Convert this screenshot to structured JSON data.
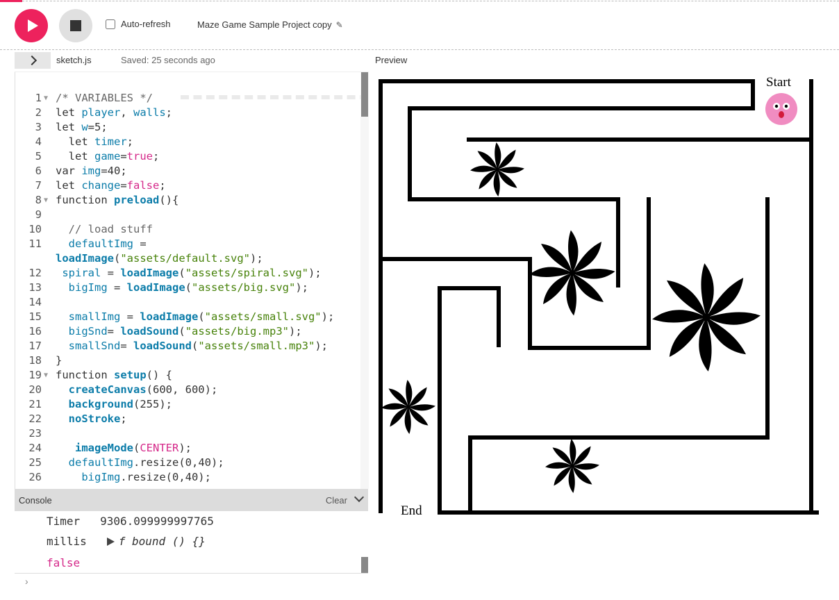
{
  "toolbar": {
    "autorefresh_label": "Auto-refresh",
    "project_name": "Maze Game Sample Project copy",
    "icons": {
      "play": "play-icon",
      "stop": "stop-icon",
      "edit": "pencil-icon"
    },
    "colors": {
      "accent": "#ed225d",
      "stop_bg": "#e0e0e0"
    }
  },
  "editor": {
    "file_name": "sketch.js",
    "saved_status": "Saved: 25 seconds ago",
    "line_numbers": [
      "1",
      "2",
      "3",
      "4",
      "5",
      "6",
      "7",
      "8",
      "9",
      "10",
      "11",
      "",
      "12",
      "13",
      "14",
      "15",
      "16",
      "17",
      "18",
      "19",
      "20",
      "21",
      "22",
      "23",
      "24",
      "25",
      "26"
    ]
  },
  "preview": {
    "label": "Preview",
    "start_label": "Start",
    "end_label": "End"
  },
  "console": {
    "title": "Console",
    "clear_label": "Clear",
    "lines": {
      "timer_key": "Timer",
      "timer_value": "9306.099999997765",
      "millis_key": "millis",
      "millis_value": "f bound () {}",
      "false_value": "false"
    }
  }
}
